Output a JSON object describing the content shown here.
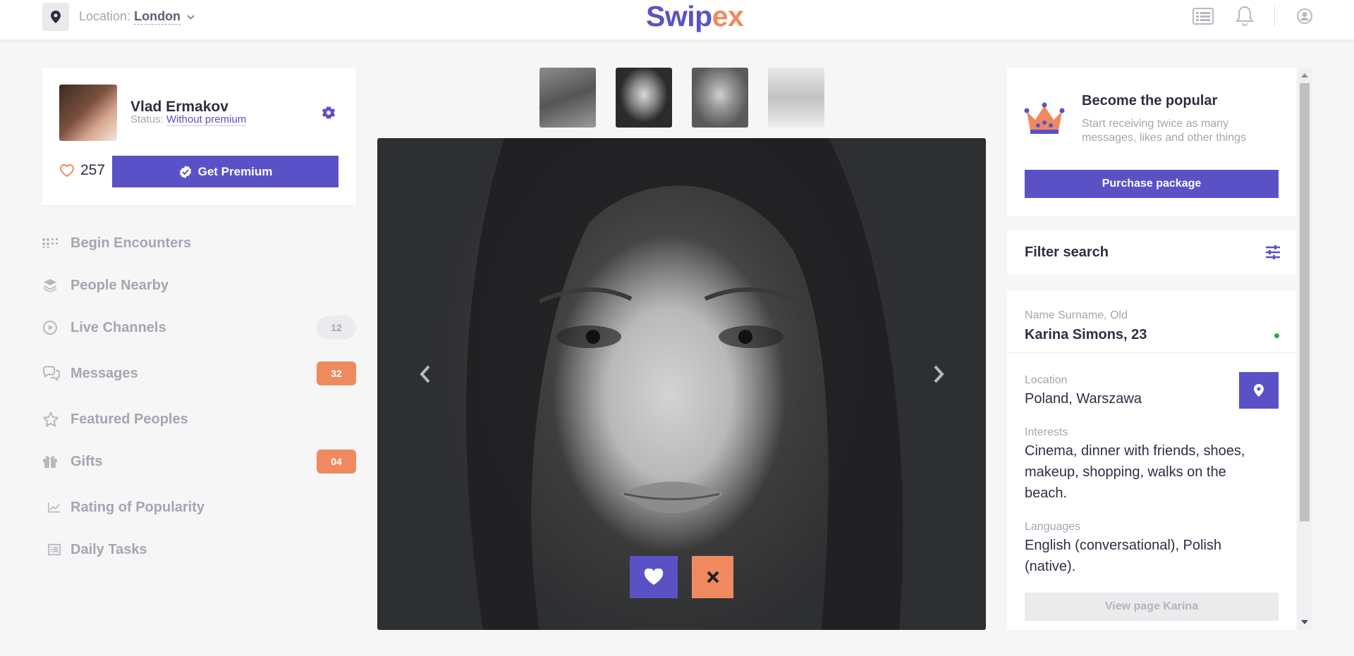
{
  "header": {
    "location_label": "Location:",
    "location_city": "London",
    "logo_part1": "Swip",
    "logo_part2": "ex"
  },
  "profile": {
    "name": "Vlad Ermakov",
    "status_label": "Status:",
    "status_value": "Without premium",
    "likes": "257",
    "premium_button": "Get Premium"
  },
  "nav": [
    {
      "label": "Begin Encounters",
      "icon": "grid-dots-icon"
    },
    {
      "label": "People Nearby",
      "icon": "layers-icon"
    },
    {
      "label": "Live Channels",
      "icon": "play-circle-icon",
      "badge": "12"
    },
    {
      "label": "Messages",
      "icon": "chat-bubbles-icon",
      "badge": "32"
    },
    {
      "label": "Featured Peoples",
      "icon": "star-icon"
    },
    {
      "label": "Gifts",
      "icon": "gift-icon",
      "badge": "04"
    },
    {
      "label": "Rating of Popularity",
      "icon": "chart-line-icon"
    },
    {
      "label": "Daily Tasks",
      "icon": "list-icon"
    }
  ],
  "promo": {
    "title": "Become the popular",
    "subtitle": "Start receiving twice as many messages, likes and other things",
    "button": "Purchase package"
  },
  "filter": {
    "title": "Filter search"
  },
  "info": {
    "name_label": "Name Surname, Old",
    "name_value": "Karina Simons, 23",
    "location_label": "Location",
    "location_value": "Poland, Warszawa",
    "interests_label": "Interests",
    "interests_value": "Cinema, dinner with friends, shoes, makeup, shopping, walks on the beach.",
    "languages_label": "Languages",
    "languages_value": "English (conversational), Polish (native).",
    "view_button": "View page Karina"
  },
  "colors": {
    "accent": "#5b51c7",
    "orange": "#ef8a60",
    "online": "#22b14c"
  }
}
